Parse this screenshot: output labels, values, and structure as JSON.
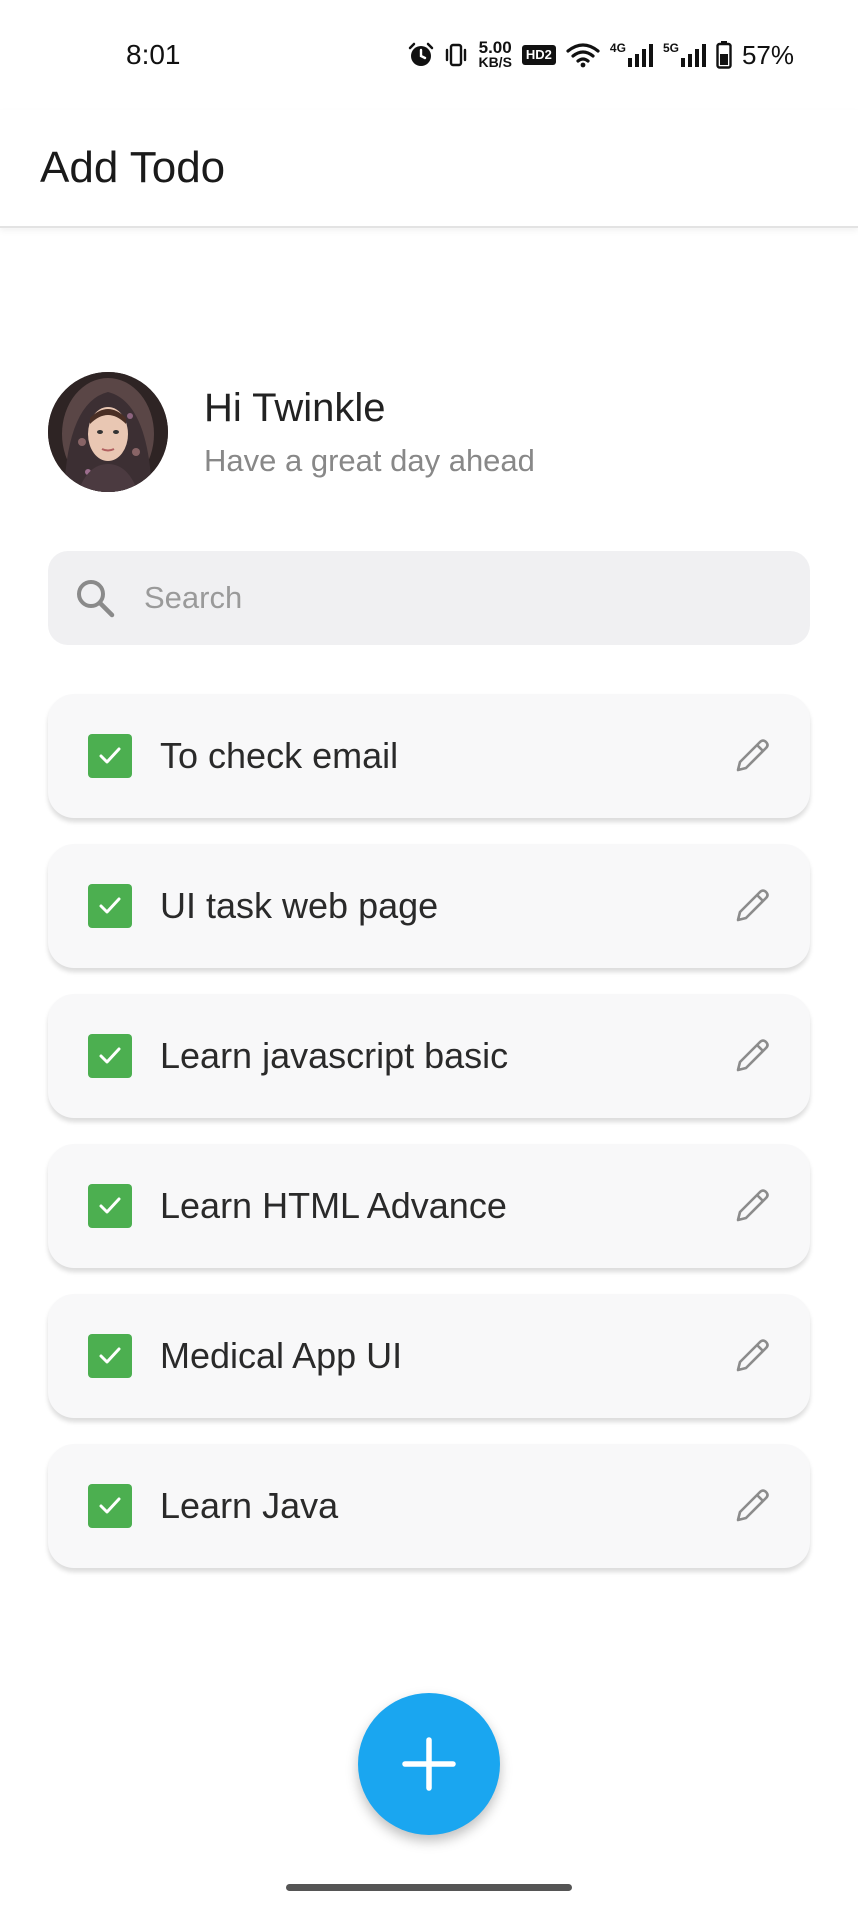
{
  "status_bar": {
    "time": "8:01",
    "speed_value": "5.00",
    "speed_unit": "KB/S",
    "hd_badge": "HD2",
    "net1": "4G",
    "net2": "5G",
    "battery": "57%",
    "icons": [
      "alarm-icon",
      "vibrate-icon",
      "wifi-icon",
      "signal-icon",
      "signal-icon",
      "battery-icon"
    ]
  },
  "app_bar": {
    "title": "Add Todo"
  },
  "profile": {
    "greeting": "Hi Twinkle",
    "subtitle": "Have a great day ahead"
  },
  "search": {
    "placeholder": "Search",
    "value": ""
  },
  "todos": [
    {
      "label": "To check email",
      "checked": true
    },
    {
      "label": "UI task web page",
      "checked": true
    },
    {
      "label": "Learn javascript basic",
      "checked": true
    },
    {
      "label": "Learn HTML Advance",
      "checked": true
    },
    {
      "label": "Medical App UI",
      "checked": true
    },
    {
      "label": "Learn Java",
      "checked": true
    }
  ],
  "colors": {
    "checkbox": "#4caf50",
    "fab": "#1aa6f0",
    "card_bg": "#f8f8f9",
    "search_bg": "#f0f0f2"
  },
  "fab": {
    "icon": "plus-icon"
  }
}
